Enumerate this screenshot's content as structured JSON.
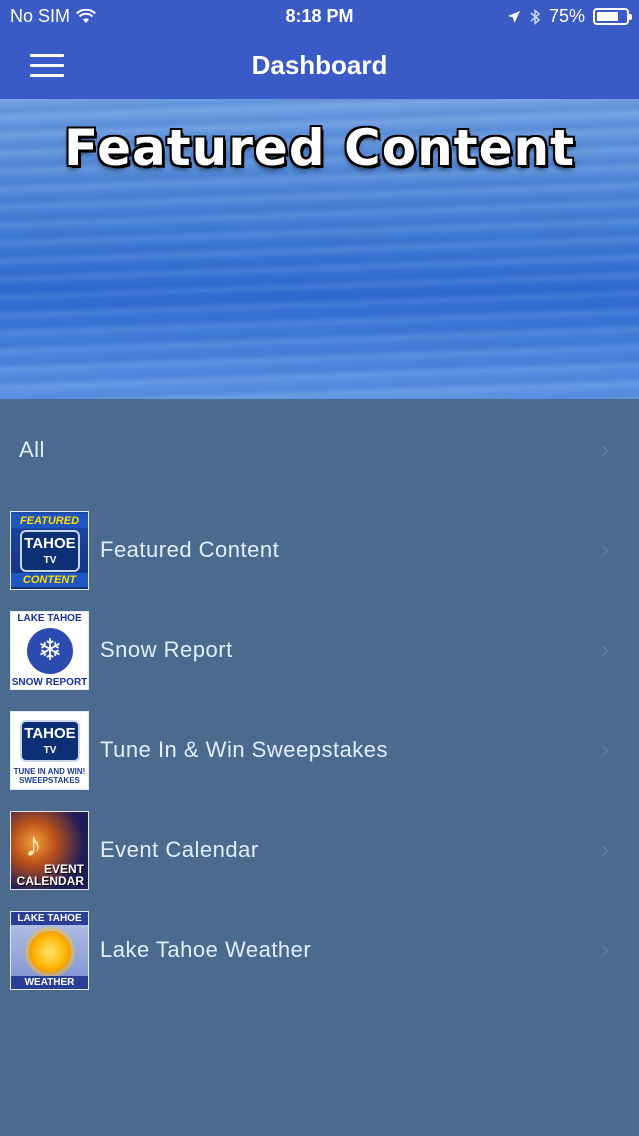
{
  "status_bar": {
    "carrier": "No SIM",
    "time": "8:18 PM",
    "battery": "75%",
    "battery_level": 0.75
  },
  "navbar": {
    "title": "Dashboard"
  },
  "banner": {
    "title": "Featured Content"
  },
  "list": {
    "all_label": "All",
    "items": [
      {
        "label": "Featured Content",
        "thumb_top": "FEATURED",
        "thumb_logo": "TAHOE",
        "thumb_logo_sub": "TV",
        "thumb_bottom": "CONTENT"
      },
      {
        "label": "Snow Report",
        "thumb_top": "LAKE TAHOE",
        "thumb_bottom": "SNOW REPORT"
      },
      {
        "label": "Tune In & Win Sweepstakes",
        "thumb_logo": "TAHOE",
        "thumb_logo_sub": "TV",
        "thumb_bottom": "TUNE IN AND WIN! SWEEPSTAKES"
      },
      {
        "label": "Event Calendar",
        "thumb_bottom": "EVENT CALENDAR"
      },
      {
        "label": "Lake Tahoe Weather",
        "thumb_top": "LAKE TAHOE",
        "thumb_bottom": "WEATHER"
      }
    ]
  }
}
